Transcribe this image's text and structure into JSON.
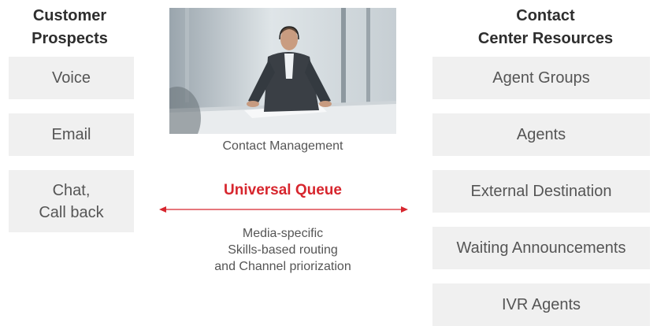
{
  "left": {
    "heading": "Customer\nProspects",
    "boxes": [
      "Voice",
      "Email",
      "Chat,\nCall back"
    ]
  },
  "right": {
    "heading": "Contact\nCenter Resources",
    "boxes": [
      "Agent Groups",
      "Agents",
      "External Destination",
      "Waiting Announcements",
      "IVR Agents"
    ]
  },
  "center": {
    "caption": "Contact Management",
    "queue_title": "Universal Queue",
    "queue_description": "Media-specific\nSkills-based routing\nand Channel priorization",
    "photo_icon": "person-at-desk-photo"
  },
  "colors": {
    "accent": "#d7262e",
    "box_bg": "#f0f0f0"
  }
}
